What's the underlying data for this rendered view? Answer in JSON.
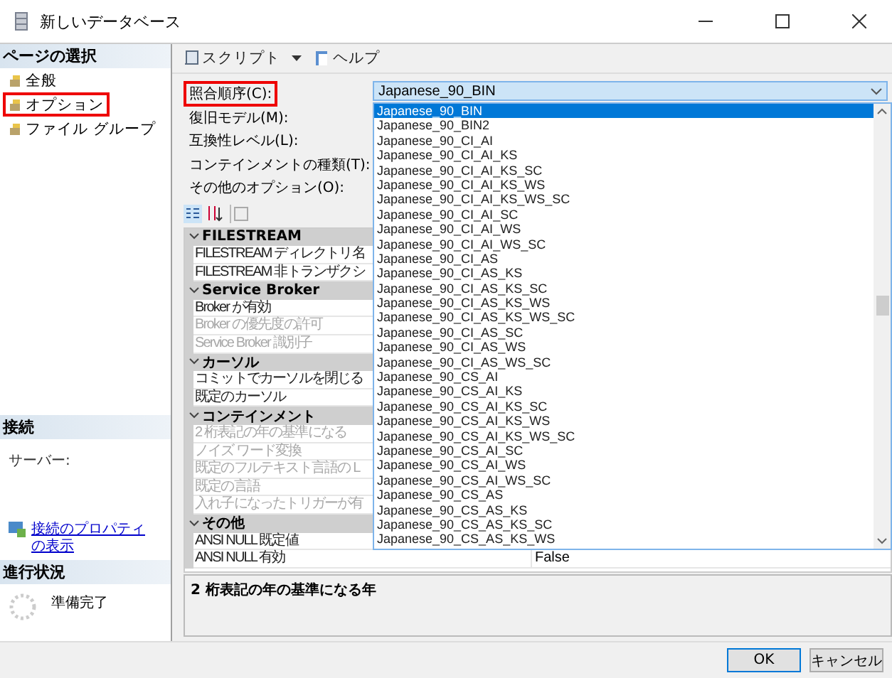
{
  "window": {
    "title": "新しいデータベース"
  },
  "sidebar": {
    "header": "ページの選択",
    "pages": [
      {
        "label": "全般",
        "selected": false
      },
      {
        "label": "オプション",
        "selected": true
      },
      {
        "label": "ファイル グループ",
        "selected": false
      }
    ]
  },
  "connection": {
    "header": "接続",
    "server_label": "サーバー:",
    "link": "接続のプロパティの表示"
  },
  "progress": {
    "header": "進行状況",
    "status": "準備完了"
  },
  "toolbar": [
    {
      "label": "スクリプト",
      "kind": "menu"
    },
    {
      "label": "ヘルプ",
      "kind": "button"
    }
  ],
  "fields": [
    {
      "label": "照合順序(C):",
      "highlighted": true
    },
    {
      "label": "復旧モデル(M):",
      "highlighted": false
    },
    {
      "label": "互換性レベル(L):",
      "highlighted": false
    },
    {
      "label": "コンテインメントの種類(T):",
      "highlighted": false
    },
    {
      "label": "その他のオプション(O):",
      "highlighted": false
    }
  ],
  "collation": {
    "value": "Japanese_90_BIN",
    "options": [
      {
        "label": "Japanese_90_BIN",
        "selected": true
      },
      {
        "label": "Japanese_90_BIN2",
        "selected": false
      },
      {
        "label": "Japanese_90_CI_AI",
        "selected": false
      },
      {
        "label": "Japanese_90_CI_AI_KS",
        "selected": false
      },
      {
        "label": "Japanese_90_CI_AI_KS_SC",
        "selected": false
      },
      {
        "label": "Japanese_90_CI_AI_KS_WS",
        "selected": false
      },
      {
        "label": "Japanese_90_CI_AI_KS_WS_SC",
        "selected": false
      },
      {
        "label": "Japanese_90_CI_AI_SC",
        "selected": false
      },
      {
        "label": "Japanese_90_CI_AI_WS",
        "selected": false
      },
      {
        "label": "Japanese_90_CI_AI_WS_SC",
        "selected": false
      },
      {
        "label": "Japanese_90_CI_AS",
        "selected": false
      },
      {
        "label": "Japanese_90_CI_AS_KS",
        "selected": false
      },
      {
        "label": "Japanese_90_CI_AS_KS_SC",
        "selected": false
      },
      {
        "label": "Japanese_90_CI_AS_KS_WS",
        "selected": false
      },
      {
        "label": "Japanese_90_CI_AS_KS_WS_SC",
        "selected": false
      },
      {
        "label": "Japanese_90_CI_AS_SC",
        "selected": false
      },
      {
        "label": "Japanese_90_CI_AS_WS",
        "selected": false
      },
      {
        "label": "Japanese_90_CI_AS_WS_SC",
        "selected": false
      },
      {
        "label": "Japanese_90_CS_AI",
        "selected": false
      },
      {
        "label": "Japanese_90_CS_AI_KS",
        "selected": false
      },
      {
        "label": "Japanese_90_CS_AI_KS_SC",
        "selected": false
      },
      {
        "label": "Japanese_90_CS_AI_KS_WS",
        "selected": false
      },
      {
        "label": "Japanese_90_CS_AI_KS_WS_SC",
        "selected": false
      },
      {
        "label": "Japanese_90_CS_AI_SC",
        "selected": false
      },
      {
        "label": "Japanese_90_CS_AI_WS",
        "selected": false
      },
      {
        "label": "Japanese_90_CS_AI_WS_SC",
        "selected": false
      },
      {
        "label": "Japanese_90_CS_AS",
        "selected": false
      },
      {
        "label": "Japanese_90_CS_AS_KS",
        "selected": false
      },
      {
        "label": "Japanese_90_CS_AS_KS_SC",
        "selected": false
      },
      {
        "label": "Japanese_90_CS_AS_KS_WS",
        "selected": false
      }
    ]
  },
  "property_grid": {
    "categories": [
      {
        "name": "FILESTREAM",
        "expanded": true,
        "rows": [
          {
            "name": "FILESTREAM ディレクトリ名",
            "disabled": false
          },
          {
            "name": "FILESTREAM 非トランザクシ",
            "disabled": false
          }
        ]
      },
      {
        "name": "Service Broker",
        "expanded": true,
        "rows": [
          {
            "name": "Broker が有効",
            "disabled": false
          },
          {
            "name": "Broker の優先度の許可",
            "disabled": true
          },
          {
            "name": "Service Broker 識別子",
            "disabled": true
          }
        ]
      },
      {
        "name": "カーソル",
        "expanded": true,
        "rows": [
          {
            "name": "コミットでカーソルを閉じる",
            "disabled": false
          },
          {
            "name": "既定のカーソル",
            "disabled": false
          }
        ]
      },
      {
        "name": "コンテインメント",
        "expanded": true,
        "rows": [
          {
            "name": "2 桁表記の年の基準になる",
            "disabled": true
          },
          {
            "name": "ノイズ ワード変換",
            "disabled": true
          },
          {
            "name": "既定のフルテキスト言語の L",
            "disabled": true
          },
          {
            "name": "既定の言語",
            "disabled": true
          },
          {
            "name": "入れ子になったトリガーが有",
            "disabled": true
          }
        ]
      },
      {
        "name": "その他",
        "expanded": true,
        "rows": [
          {
            "name": "ANSI NULL 既定値",
            "disabled": false
          },
          {
            "name": "ANSI NULL 有効",
            "disabled": false,
            "value": "False"
          }
        ]
      }
    ]
  },
  "description": "2 桁表記の年の基準になる年",
  "buttons": [
    {
      "label": "OK",
      "default": true
    },
    {
      "label": "キャンセル",
      "default": false
    }
  ]
}
